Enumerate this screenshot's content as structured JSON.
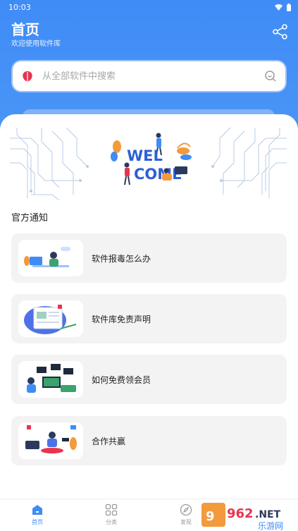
{
  "status_bar": {
    "time": "10:03"
  },
  "header": {
    "title": "首页",
    "subtitle": "欢迎使用软件库"
  },
  "search": {
    "placeholder": "从全部软件中搜索"
  },
  "banner": {
    "text_line1": "WEL",
    "text_line2": "COME"
  },
  "notices": {
    "title": "官方通知",
    "items": [
      {
        "label": "软件报毒怎么办"
      },
      {
        "label": "软件库免责声明"
      },
      {
        "label": "如何免费领会员"
      },
      {
        "label": "合作共赢"
      }
    ]
  },
  "nav": {
    "items": [
      {
        "label": "首页",
        "icon": "home-icon",
        "active": true
      },
      {
        "label": "分类",
        "icon": "grid-icon",
        "active": false
      },
      {
        "label": "发现",
        "icon": "compass-icon",
        "active": false
      }
    ]
  },
  "watermark": {
    "number": "962",
    "suffix": ".NET",
    "brand": "乐游网"
  },
  "colors": {
    "primary": "#3f8cf7",
    "card": "#f3f3f3",
    "brand_red": "#e8344e"
  }
}
